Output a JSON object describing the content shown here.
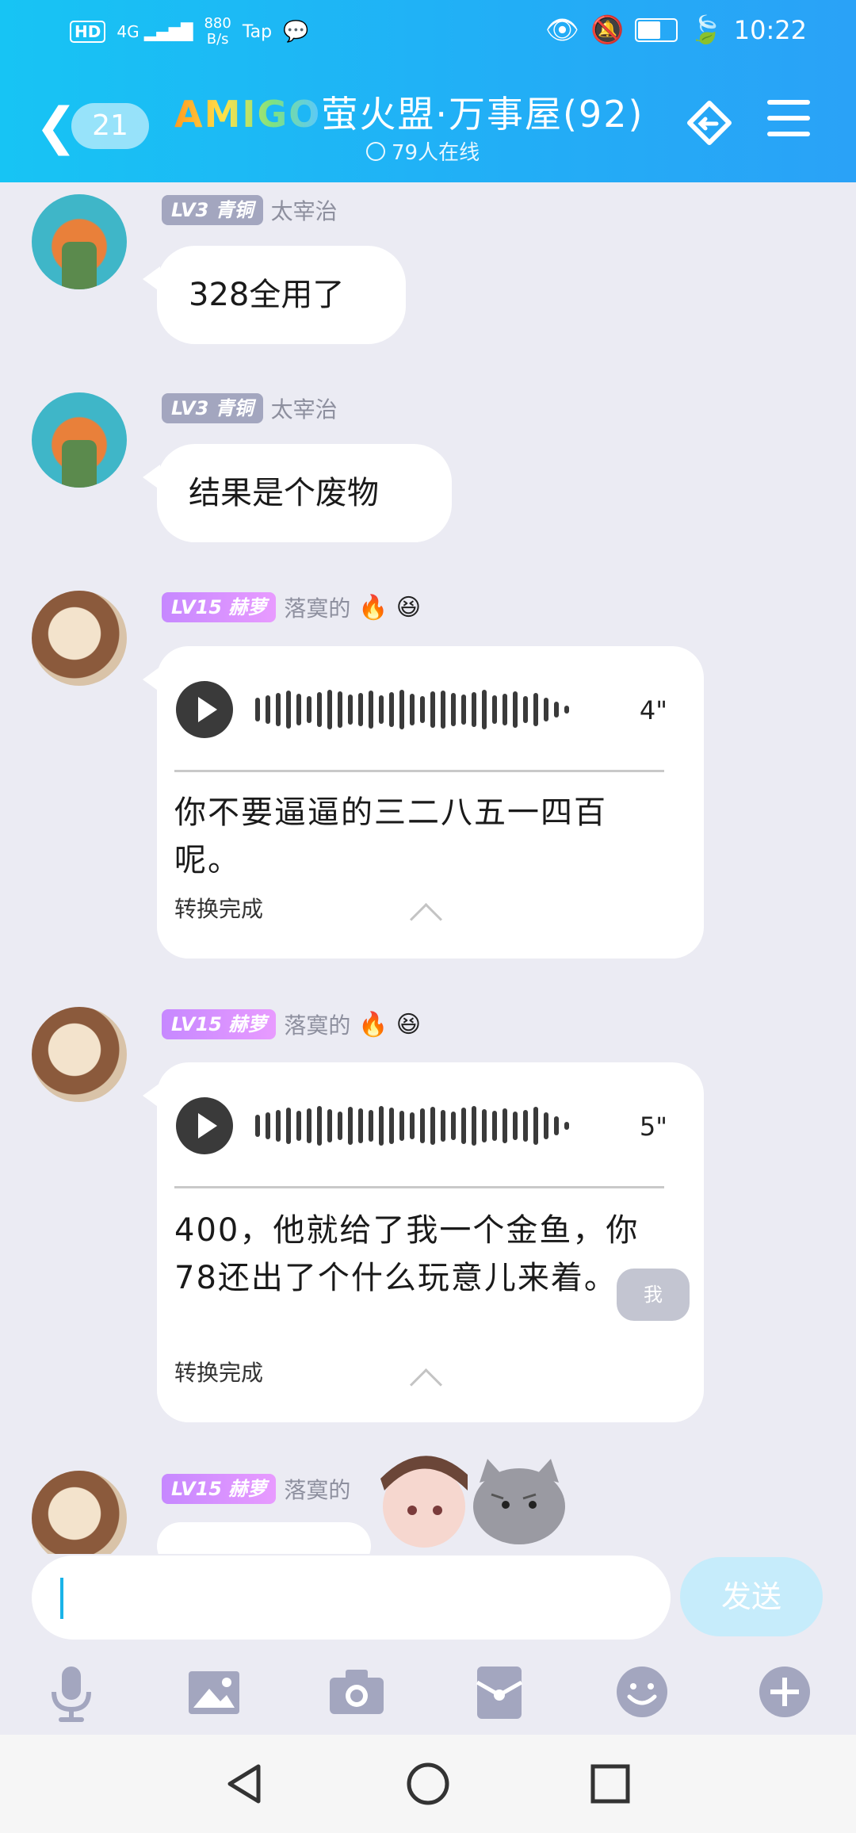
{
  "status_bar": {
    "hd": "HD",
    "signal": "4G",
    "net_speed": "880",
    "net_unit": "B/s",
    "app": "Tap",
    "time": "10:22",
    "battery": "49"
  },
  "header": {
    "unread_count": "21",
    "title_prefix": "AMIGO",
    "title_rest": "萤火盟·万事屋(92)",
    "online_text": "79人在线"
  },
  "messages": [
    {
      "level": "LV3 青铜",
      "nick": "太宰治",
      "text": "328全用了"
    },
    {
      "level": "LV3 青铜",
      "nick": "太宰治",
      "text": "结果是个废物"
    },
    {
      "level": "LV15 赫萝",
      "nick": "落寞的",
      "emoji1": "🔥",
      "emoji2": "😆",
      "duration": "4\"",
      "transcript": "你不要逼逼的三二八五一四百呢。",
      "status": "转换完成"
    },
    {
      "level": "LV15 赫萝",
      "nick": "落寞的",
      "emoji1": "🔥",
      "emoji2": "😆",
      "duration": "5\"",
      "transcript": "400，他就给了我一个金鱼，你78还出了个什么玩意儿来着。",
      "status": "转换完成"
    },
    {
      "level": "LV15 赫萝",
      "nick": "落寞的"
    }
  ],
  "me_badge": "我",
  "input": {
    "placeholder": "",
    "send_label": "发送"
  },
  "toolbar": [
    "mic-icon",
    "image-icon",
    "camera-icon",
    "red-packet-icon",
    "emoji-icon",
    "plus-icon"
  ],
  "colors": {
    "header_start": "#17c4f4",
    "header_end": "#2aa2f7",
    "accent": "#1ab3e8",
    "level_gray": "#a3a6bf",
    "level_purple": "#c688ff"
  }
}
